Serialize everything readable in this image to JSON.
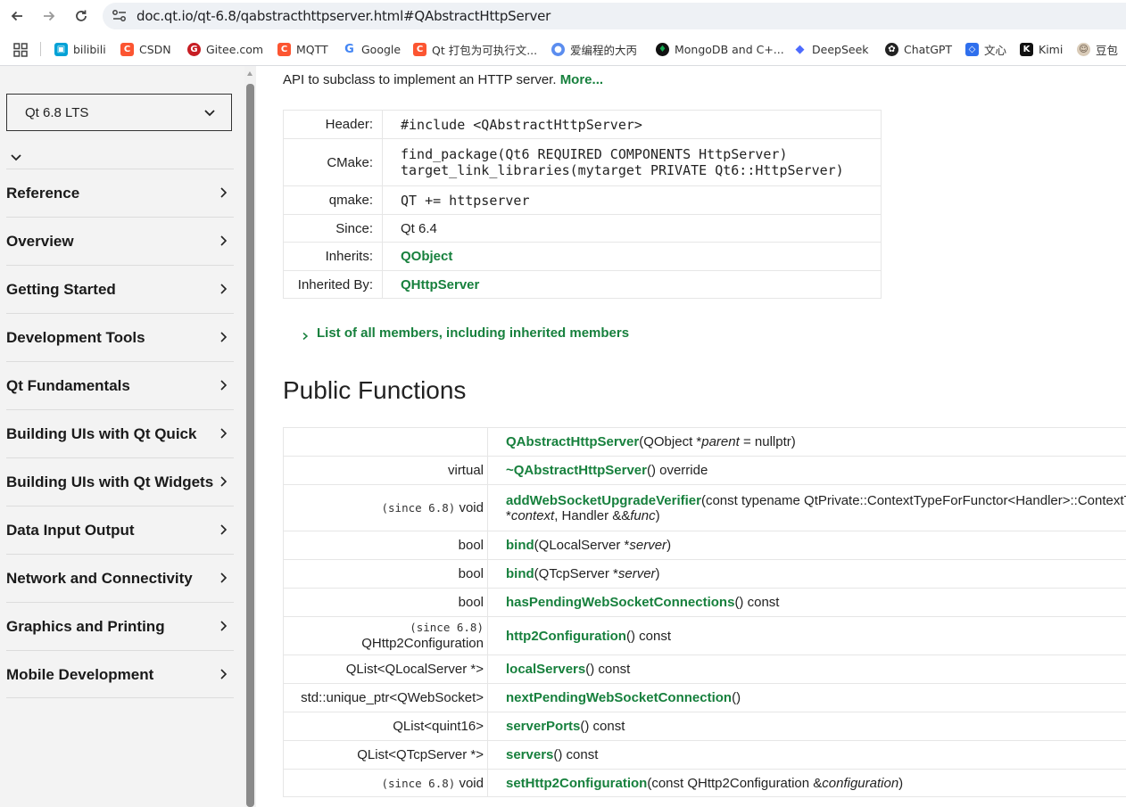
{
  "browser": {
    "url": "doc.qt.io/qt-6.8/qabstracthttpserver.html#QAbstractHttpServer",
    "bookmarks": [
      {
        "label": "bilibili",
        "icon": "bilibili-icon",
        "color": "#00a1d6"
      },
      {
        "label": "CSDN",
        "icon": "csdn-icon",
        "color": "#fc5531"
      },
      {
        "label": "Gitee.com",
        "icon": "gitee-icon",
        "color": "#c71d23"
      },
      {
        "label": "MQTT",
        "icon": "csdn-icon",
        "color": "#fc5531"
      },
      {
        "label": "Google",
        "icon": "google-icon",
        "color": "#4285f4"
      },
      {
        "label": "Qt 打包为可执行文...",
        "icon": "csdn-icon",
        "color": "#fc5531"
      },
      {
        "label": "爱编程的大丙",
        "icon": "site-icon",
        "color": "#5b8def"
      },
      {
        "label": "MongoDB and C+...",
        "icon": "mongodb-icon",
        "color": "#13aa52"
      },
      {
        "label": "DeepSeek",
        "icon": "deepseek-icon",
        "color": "#4d6bfe"
      },
      {
        "label": "ChatGPT",
        "icon": "chatgpt-icon",
        "color": "#222222"
      },
      {
        "label": "文心",
        "icon": "wenxin-icon",
        "color": "#2f6fed"
      },
      {
        "label": "Kimi",
        "icon": "kimi-icon",
        "color": "#111111"
      },
      {
        "label": "豆包",
        "icon": "doubao-icon",
        "color": "#7a6a5a"
      }
    ]
  },
  "sidebar": {
    "version": "Qt 6.8 LTS",
    "items": [
      {
        "label": "Reference"
      },
      {
        "label": "Overview"
      },
      {
        "label": "Getting Started"
      },
      {
        "label": "Development Tools"
      },
      {
        "label": "Qt Fundamentals"
      },
      {
        "label": "Building UIs with Qt Quick"
      },
      {
        "label": "Building UIs with Qt Widgets"
      },
      {
        "label": "Data Input Output"
      },
      {
        "label": "Network and Connectivity"
      },
      {
        "label": "Graphics and Printing"
      },
      {
        "label": "Mobile Development"
      }
    ]
  },
  "main": {
    "brief": "API to subclass to implement an HTTP server.",
    "more": "More...",
    "info": {
      "header": {
        "key": "Header:",
        "value": "#include <QAbstractHttpServer>"
      },
      "cmake": {
        "key": "CMake:",
        "line1": "find_package(Qt6 REQUIRED COMPONENTS HttpServer)",
        "line2": "target_link_libraries(mytarget PRIVATE Qt6::HttpServer)"
      },
      "qmake": {
        "key": "qmake:",
        "value": "QT += httpserver"
      },
      "since": {
        "key": "Since:",
        "value": "Qt 6.4"
      },
      "inherits": {
        "key": "Inherits:",
        "value": "QObject"
      },
      "inherited_by": {
        "key": "Inherited By:",
        "value": "QHttpServer"
      }
    },
    "members_link": "List of all members, including inherited members",
    "section_title": "Public Functions",
    "functions": {
      "r0": {
        "ret": "",
        "name": "QAbstractHttpServer",
        "a1": "(QObject *",
        "a2": "parent",
        "a3": " = nullptr)"
      },
      "r1": {
        "ret": "virtual",
        "name": "~QAbstractHttpServer",
        "a1": "() override"
      },
      "r2": {
        "since": "(since 6.8)",
        "ret": "void",
        "name": "addWebSocketUpgradeVerifier",
        "a1": "(const typename QtPrivate::ContextTypeForFunctor<Handler>::ContextType",
        "l2a": "*",
        "l2b": "context",
        "l2c": ", Handler &&",
        "l2d": "func",
        "l2e": ")"
      },
      "r3": {
        "ret": "bool",
        "name": "bind",
        "a1": "(QLocalServer *",
        "a2": "server",
        "a3": ")"
      },
      "r4": {
        "ret": "bool",
        "name": "bind",
        "a1": "(QTcpServer *",
        "a2": "server",
        "a3": ")"
      },
      "r5": {
        "ret": "bool",
        "name": "hasPendingWebSocketConnections",
        "a1": "() const"
      },
      "r6": {
        "since": "(since 6.8)",
        "ret": "QHttp2Configuration",
        "name": "http2Configuration",
        "a1": "() const"
      },
      "r7": {
        "ret": "QList<QLocalServer *>",
        "name": "localServers",
        "a1": "() const"
      },
      "r8": {
        "ret": "std::unique_ptr<QWebSocket>",
        "name": "nextPendingWebSocketConnection",
        "a1": "()"
      },
      "r9": {
        "ret": "QList<quint16>",
        "name": "serverPorts",
        "a1": "() const"
      },
      "r10": {
        "ret": "QList<QTcpServer *>",
        "name": "servers",
        "a1": "() const"
      },
      "r11": {
        "since": "(since 6.8)",
        "ret": "void",
        "name": "setHttp2Configuration",
        "a1": "(const QHttp2Configuration &",
        "a2": "configuration",
        "a3": ")"
      }
    }
  }
}
